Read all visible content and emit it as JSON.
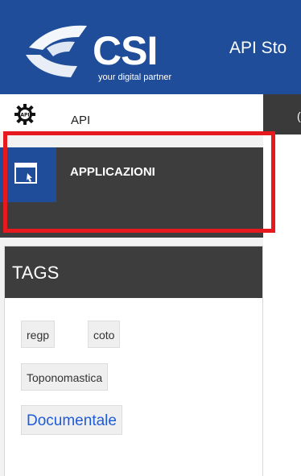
{
  "header": {
    "logo_word": "CSI",
    "logo_tagline": "your digital partner",
    "store_title": "API Sto",
    "brand_color": "#1f4d9a"
  },
  "sidebar": {
    "items": [
      {
        "label": "API",
        "icon": "gear-api-icon"
      },
      {
        "label": "APPLICAZIONI",
        "icon": "application-window-icon",
        "active": true
      }
    ]
  },
  "right_strip": {
    "text": "("
  },
  "tags": {
    "title": "TAGS",
    "items": [
      "regp",
      "coto",
      "Toponomastica",
      "Documentale"
    ]
  },
  "colors": {
    "highlight": "#e6191f",
    "dark_panel": "#3d3d3d"
  }
}
